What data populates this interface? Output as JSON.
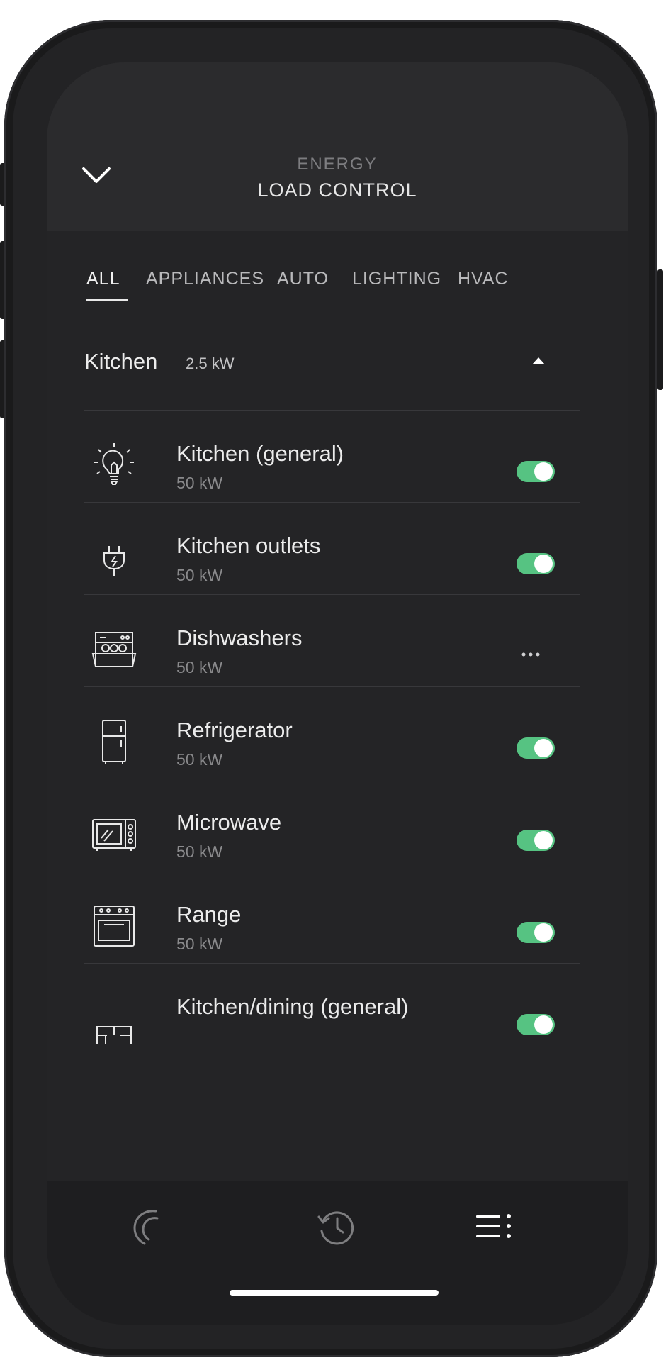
{
  "header": {
    "supertitle": "ENERGY",
    "title": "LOAD CONTROL",
    "back_icon": "chevron-down-icon"
  },
  "tabs": [
    {
      "label": "ALL",
      "active": true
    },
    {
      "label": "APPLIANCES",
      "active": false
    },
    {
      "label": "AUTO",
      "active": false
    },
    {
      "label": "LIGHTING",
      "active": false
    },
    {
      "label": "HVAC",
      "active": false
    }
  ],
  "group": {
    "name": "Kitchen",
    "power": "2.5 kW",
    "expanded": true,
    "icon": "caret-up-icon"
  },
  "loads": [
    {
      "name": "Kitchen (general)",
      "power": "50 kW",
      "icon": "lightbulb-icon",
      "state": "on"
    },
    {
      "name": "Kitchen outlets",
      "power": "50 kW",
      "icon": "plug-icon",
      "state": "on"
    },
    {
      "name": "Dishwashers",
      "power": "50 kW",
      "icon": "dishwasher-icon",
      "state": "pending"
    },
    {
      "name": "Refrigerator",
      "power": "50 kW",
      "icon": "refrigerator-icon",
      "state": "on"
    },
    {
      "name": "Microwave",
      "power": "50 kW",
      "icon": "microwave-icon",
      "state": "on"
    },
    {
      "name": "Range",
      "power": "50 kW",
      "icon": "range-icon",
      "state": "on"
    },
    {
      "name": "Kitchen/dining (general)",
      "power": "",
      "icon": "floorplan-icon",
      "state": "on"
    }
  ],
  "tabbar": {
    "items": [
      {
        "icon": "energy-gauge-icon",
        "active": false
      },
      {
        "icon": "history-icon",
        "active": false
      },
      {
        "icon": "menu-list-icon",
        "active": true
      }
    ]
  },
  "colors": {
    "toggle_on": "#56c382",
    "background": "#242426",
    "text_primary": "#ececec",
    "text_secondary": "#8a8a8c"
  }
}
